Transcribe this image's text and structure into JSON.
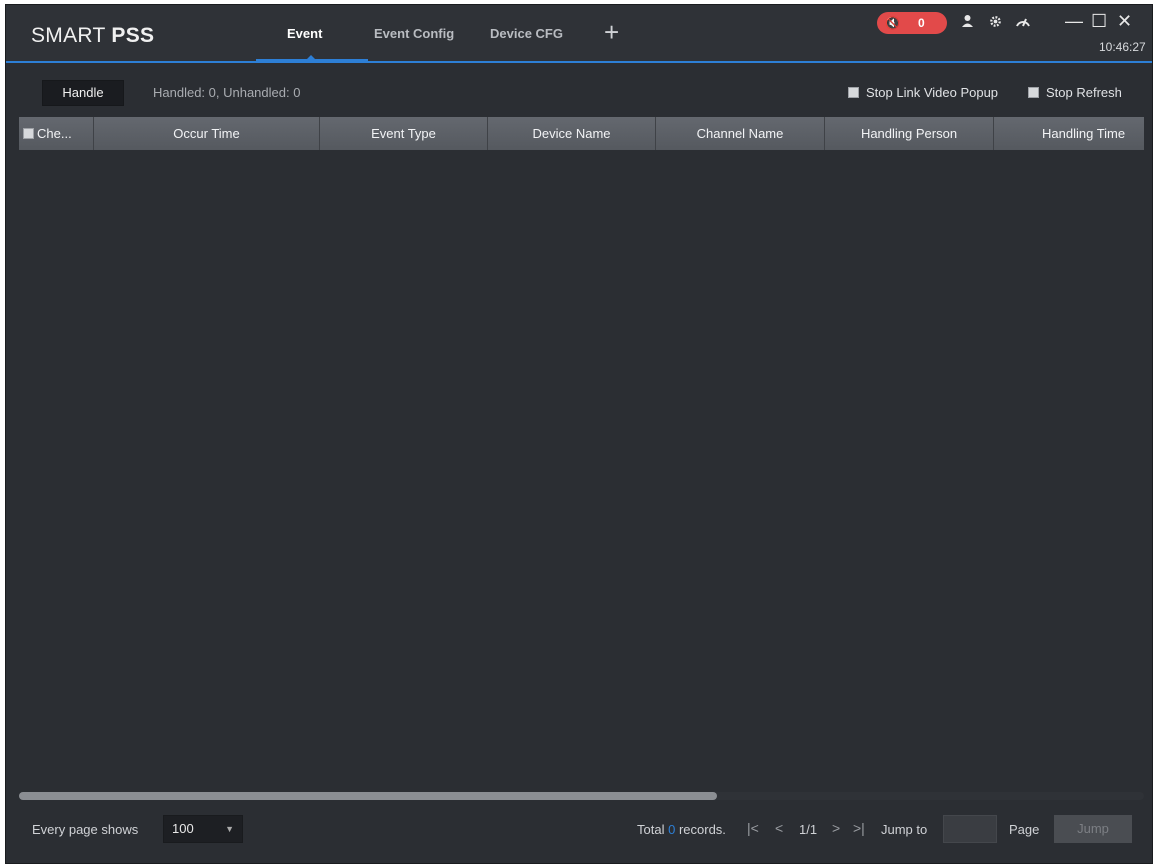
{
  "app": {
    "logo_light": "SMART ",
    "logo_bold": "PSS"
  },
  "tabs": [
    {
      "label": "Event",
      "active": true
    },
    {
      "label": "Event Config",
      "active": false
    },
    {
      "label": "Device CFG",
      "active": false
    }
  ],
  "add_tab_label": "+",
  "alarm": {
    "mute_glyph": "🔇",
    "count": "0"
  },
  "title_icons": {
    "user": "user-icon",
    "settings": "gear-icon",
    "performance": "speedometer-icon"
  },
  "window_controls": {
    "minimize": "—",
    "maximize": "☐",
    "close": "✕"
  },
  "clock": "10:46:27",
  "toolbar": {
    "handle_label": "Handle",
    "status_text": "Handled: 0, Unhandled: 0",
    "stop_link_video_popup": "Stop Link Video Popup",
    "stop_refresh": "Stop Refresh"
  },
  "table": {
    "columns": [
      "Che...",
      "Occur Time",
      "Event Type",
      "Device Name",
      "Channel Name",
      "Handling Person",
      "Handling Time"
    ],
    "rows": []
  },
  "footer": {
    "every_page_shows": "Every page shows",
    "page_size": "100",
    "total_prefix": "Total",
    "total_count": "0",
    "total_suffix": "records.",
    "nav_first": "|<",
    "nav_prev": "<",
    "page_current": "1/1",
    "nav_next": ">",
    "nav_last": ">|",
    "jump_to": "Jump to",
    "jump_value": "",
    "page_label": "Page",
    "jump_button": "Jump"
  },
  "colors": {
    "accent": "#2d7fd6",
    "alarm": "#e24a4a",
    "background": "#2b2e33"
  }
}
